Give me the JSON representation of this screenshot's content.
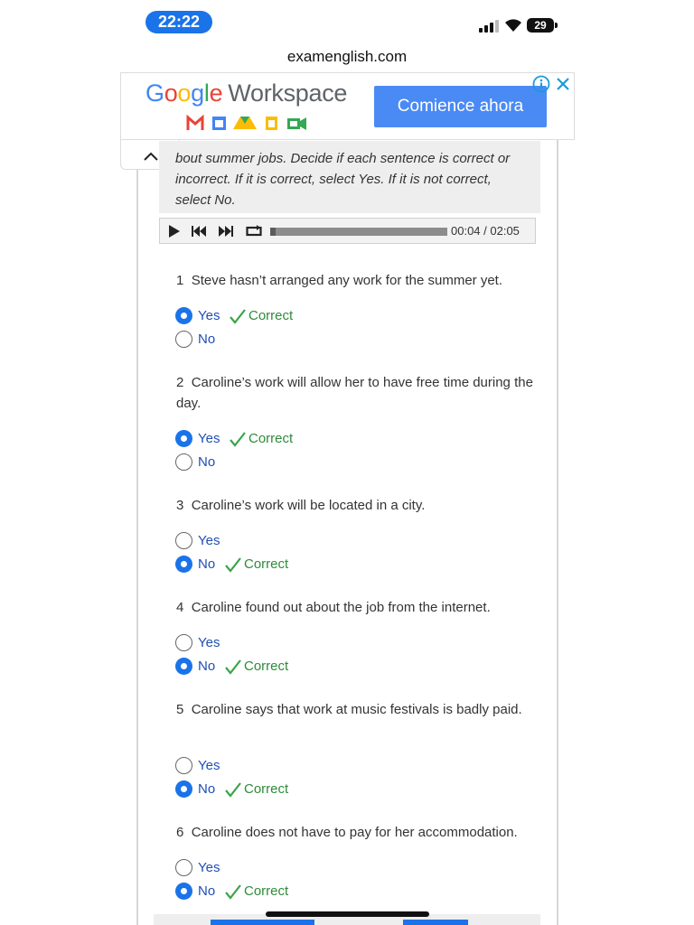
{
  "status_bar": {
    "time": "22:22",
    "battery": "29"
  },
  "browser": {
    "url": "examenglish.com"
  },
  "ad": {
    "google": [
      "G",
      "o",
      "o",
      "g",
      "l",
      "e"
    ],
    "workspace": "Workspace",
    "cta": "Comience ahora",
    "colors": {
      "blue": "#4285f4",
      "red": "#ea4335",
      "yellow": "#fbbc05",
      "green": "#34a853",
      "button": "#4a8af4"
    }
  },
  "instructions": "bout summer jobs. Decide if each sentence is correct or incorrect. If it is correct, select Yes. If it is not correct, select No.",
  "player": {
    "time": "00:04 / 02:05",
    "progress": 0.032
  },
  "questions": [
    {
      "number": "1",
      "text": "Steve hasn’t arranged any work for the summer yet.",
      "selected": "Yes",
      "feedback": "Correct"
    },
    {
      "number": "2",
      "text": "Caroline’s work will allow her to have free time during the day.",
      "selected": "Yes",
      "feedback": "Correct"
    },
    {
      "number": "3",
      "text": "Caroline’s work will be located in a city.",
      "selected": "No",
      "feedback": "Correct"
    },
    {
      "number": "4",
      "text": "Caroline found out about the job from the internet.",
      "selected": "No",
      "feedback": "Correct"
    },
    {
      "number": "5",
      "text": "Caroline says that work at music festivals is badly paid.",
      "selected": "No",
      "feedback": "Correct"
    },
    {
      "number": "6",
      "text": "Caroline does not have to pay for her accommodation.",
      "selected": "No",
      "feedback": "Correct"
    }
  ],
  "options": {
    "yes": "Yes",
    "no": "No"
  },
  "colors": {
    "accent": "#1a73e8",
    "option_text": "#1f4fb5",
    "correct": "#2e8b3a"
  }
}
